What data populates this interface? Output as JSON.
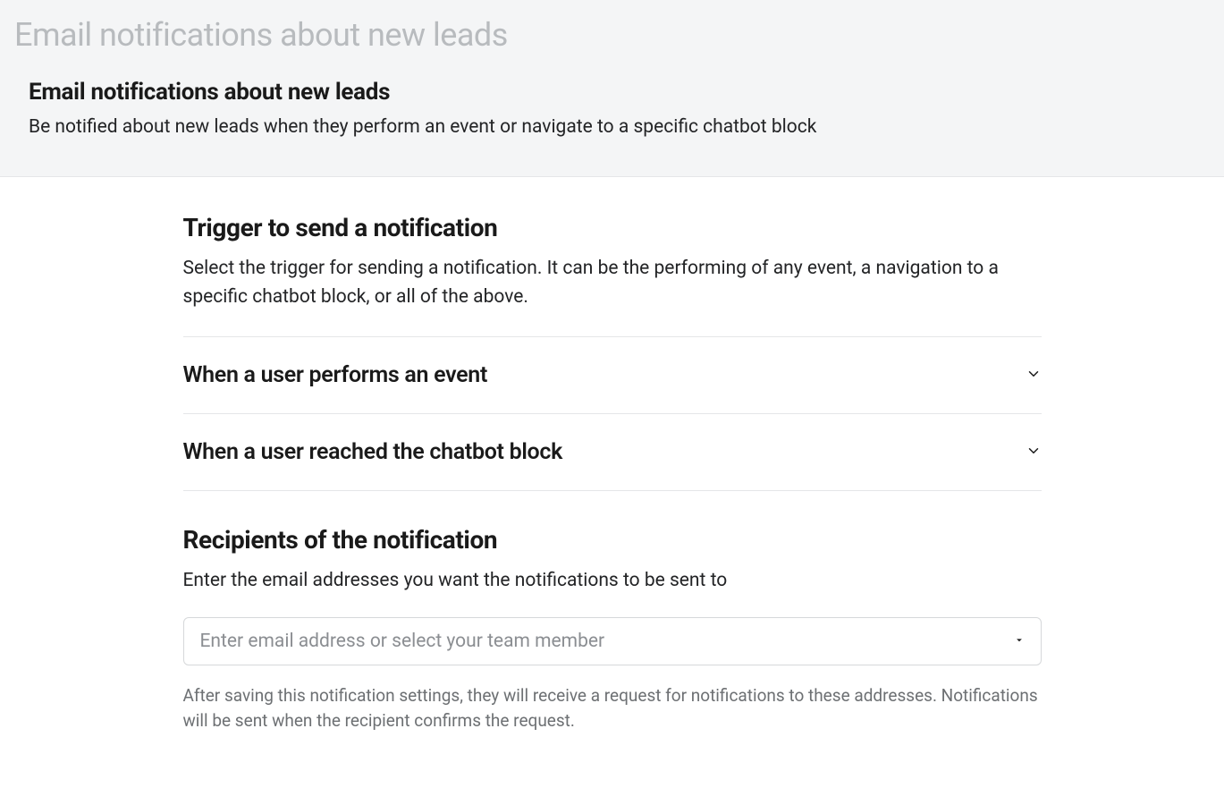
{
  "page": {
    "outer_title": "Email notifications about new leads"
  },
  "header": {
    "title": "Email notifications about new leads",
    "subtitle": "Be notified about new leads when they perform an event or navigate to a specific chatbot block"
  },
  "trigger": {
    "title": "Trigger to send a notification",
    "description": "Select the trigger for sending a notification. It can be the performing of any event, a navigation to a specific chatbot block, or all of the above.",
    "items": [
      {
        "label": "When a user performs an event"
      },
      {
        "label": "When a user reached the chatbot block"
      }
    ]
  },
  "recipients": {
    "title": "Recipients of the notification",
    "description": "Enter the email addresses you want the notifications to be sent to",
    "input_placeholder": "Enter email address or select your team member",
    "footnote": "After saving this notification settings, they will receive a request for notifications to these addresses. Notifications will be sent when the recipient confirms the request."
  }
}
